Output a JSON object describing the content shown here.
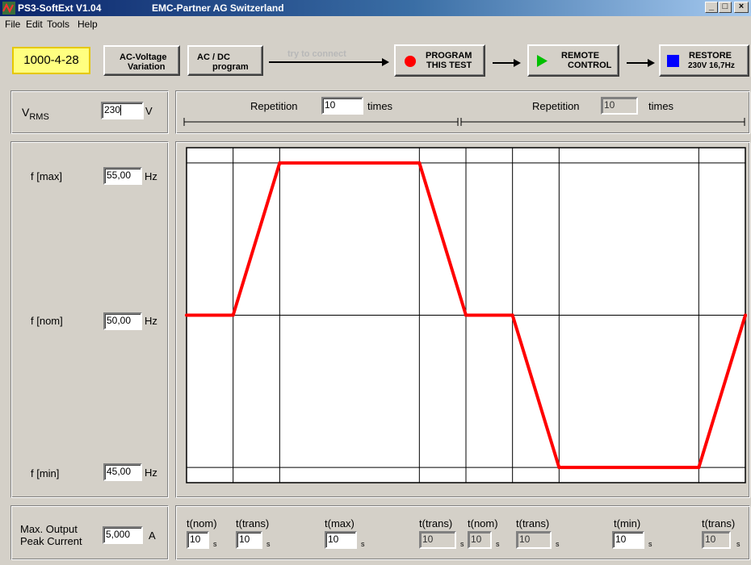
{
  "window": {
    "app_title": "PS3-SoftExt  V1.04",
    "company": "EMC-Partner AG Switzerland",
    "controls": [
      "_",
      "□",
      "×"
    ]
  },
  "menu": [
    "File",
    "Edit",
    "Tools",
    "Help"
  ],
  "toolbar": {
    "standard_button": "1000-4-28",
    "ac_voltage_line1": "AC-Voltage",
    "ac_voltage_line2": "Variation",
    "acdc_line1": "AC / DC",
    "acdc_line2": "program",
    "connect_hint": "try to connect",
    "program_line1": "PROGRAM",
    "program_line2": "THIS TEST",
    "remote_line1": "REMOTE",
    "remote_line2": "CONTROL",
    "restore_line1": "RESTORE",
    "restore_line2": "230V 16,7Hz",
    "colors": {
      "program_icon": "#ff0000",
      "remote_icon": "#00c000",
      "restore_icon": "#0000ff",
      "standard_bg": "#ffff80"
    }
  },
  "vrms": {
    "label": "V",
    "label_sub": "RMS",
    "value": "230",
    "unit": "V"
  },
  "repetitions": [
    {
      "label": "Repetition",
      "value": "10",
      "unit": "times",
      "editable": true
    },
    {
      "label": "Repetition",
      "value": "10",
      "unit": "times",
      "editable": false
    }
  ],
  "frequencies": [
    {
      "label": "f [max]",
      "value": "55,00",
      "unit": "Hz"
    },
    {
      "label": "f [nom]",
      "value": "50,00",
      "unit": "Hz"
    },
    {
      "label": "f [min]",
      "value": "45,00",
      "unit": "Hz"
    }
  ],
  "current": {
    "label_line1": "Max. Output",
    "label_line2": "Peak Current",
    "value": "5,000",
    "unit": "A"
  },
  "times": [
    {
      "label": "t(nom)",
      "value": "10",
      "unit": "s",
      "editable": true
    },
    {
      "label": "t(trans)",
      "value": "10",
      "unit": "s",
      "editable": true
    },
    {
      "label": "t(max)",
      "value": "10",
      "unit": "s",
      "editable": true
    },
    {
      "label": "t(trans)",
      "value": "10",
      "unit": "s",
      "editable": false
    },
    {
      "label": "t(nom)",
      "value": "10",
      "unit": "s",
      "editable": false
    },
    {
      "label": "t(trans)",
      "value": "10",
      "unit": "s",
      "editable": false
    },
    {
      "label": "t(min)",
      "value": "10",
      "unit": "s",
      "editable": true
    },
    {
      "label": "t(trans)",
      "value": "10",
      "unit": "s",
      "editable": false
    }
  ],
  "chart_data": {
    "type": "line",
    "x": [
      0,
      1,
      2,
      5,
      6,
      7,
      8,
      11,
      12
    ],
    "y": [
      50,
      50,
      55,
      55,
      50,
      50,
      45,
      45,
      50
    ],
    "ylim": [
      44.5,
      55.5
    ],
    "grid": true,
    "line_color": "#ff0000"
  }
}
